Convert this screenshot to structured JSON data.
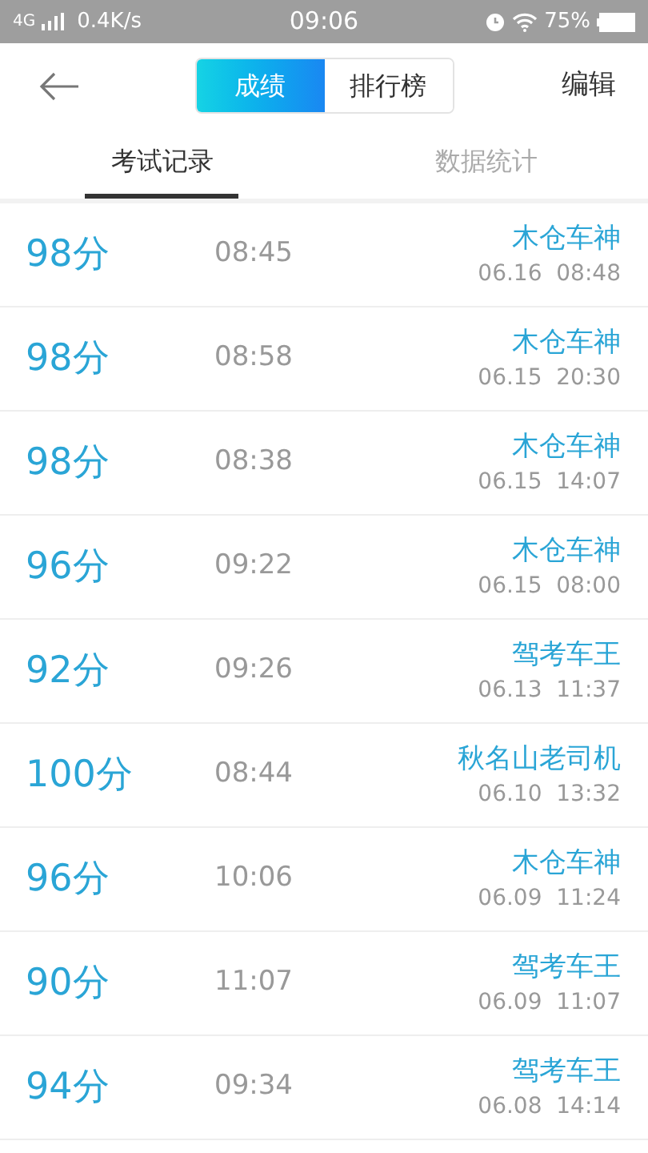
{
  "status_bar": {
    "network": "4G",
    "speed": "0.4K/s",
    "time": "09:06",
    "battery": "75%"
  },
  "header": {
    "segments": [
      {
        "label": "成绩",
        "selected": true
      },
      {
        "label": "排行榜",
        "selected": false
      }
    ],
    "action": "编辑"
  },
  "tabs": [
    {
      "label": "考试记录",
      "selected": true
    },
    {
      "label": "数据统计",
      "selected": false
    }
  ],
  "records": [
    {
      "score": "98分",
      "duration": "08:45",
      "title": "木仓车神",
      "date": "06.16  08:48"
    },
    {
      "score": "98分",
      "duration": "08:58",
      "title": "木仓车神",
      "date": "06.15  20:30"
    },
    {
      "score": "98分",
      "duration": "08:38",
      "title": "木仓车神",
      "date": "06.15  14:07"
    },
    {
      "score": "96分",
      "duration": "09:22",
      "title": "木仓车神",
      "date": "06.15  08:00"
    },
    {
      "score": "92分",
      "duration": "09:26",
      "title": "驾考车王",
      "date": "06.13  11:37"
    },
    {
      "score": "100分",
      "duration": "08:44",
      "title": "秋名山老司机",
      "date": "06.10  13:32"
    },
    {
      "score": "96分",
      "duration": "10:06",
      "title": "木仓车神",
      "date": "06.09  11:24"
    },
    {
      "score": "90分",
      "duration": "11:07",
      "title": "驾考车王",
      "date": "06.09  11:07"
    },
    {
      "score": "94分",
      "duration": "09:34",
      "title": "驾考车王",
      "date": "06.08  14:14"
    }
  ]
}
